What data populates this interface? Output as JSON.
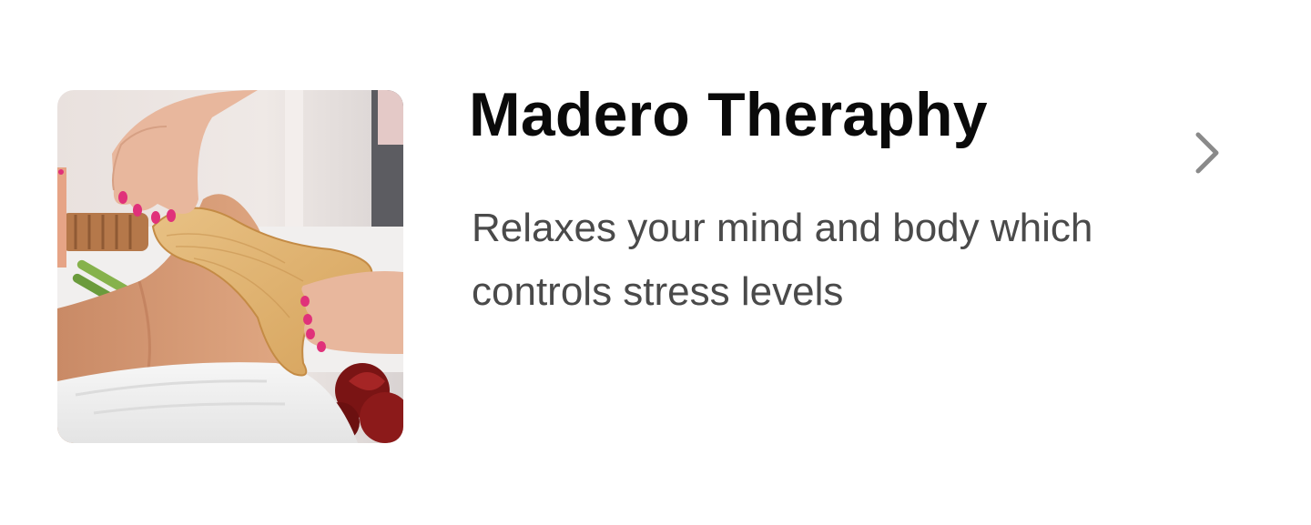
{
  "service": {
    "title": "Madero Theraphy",
    "description": "Relaxes your mind and body which controls stress levels",
    "image_icon": "massage-photo",
    "chevron_icon": "chevron-right-icon"
  },
  "colors": {
    "title": "#0a0a0a",
    "description": "#4a4a4a",
    "chevron": "#8a8a8a"
  }
}
